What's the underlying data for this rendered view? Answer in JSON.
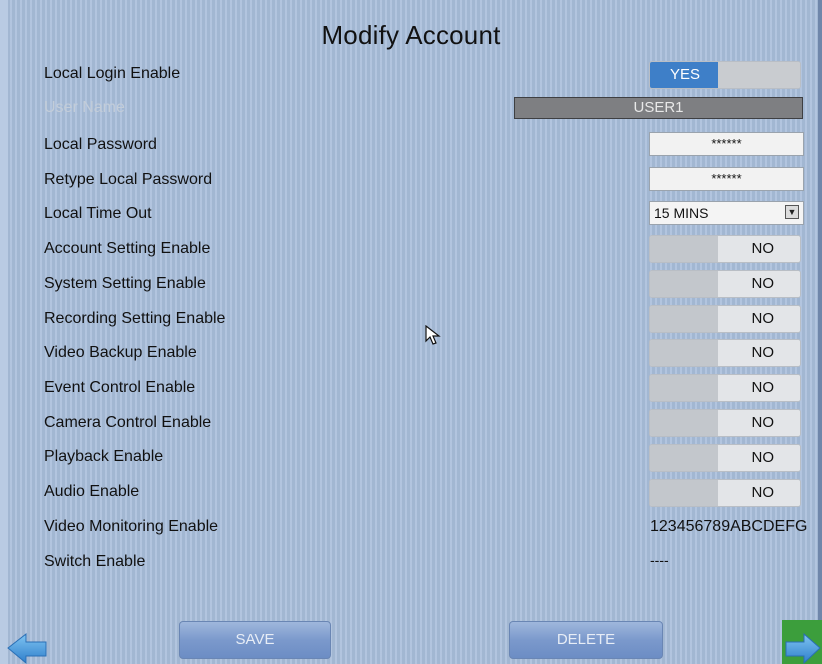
{
  "title": "Modify Account",
  "fields": {
    "local_login": {
      "label": "Local Login Enable",
      "state": "YES"
    },
    "user_name": {
      "label": "User Name",
      "value": "USER1"
    },
    "local_password": {
      "label": "Local Password",
      "value": "******"
    },
    "retype_password": {
      "label": "Retype Local Password",
      "value": "******"
    },
    "local_timeout": {
      "label": "Local Time Out",
      "value": "15 MINS"
    },
    "account_setting": {
      "label": "Account Setting Enable",
      "state": "NO"
    },
    "system_setting": {
      "label": "System Setting Enable",
      "state": "NO"
    },
    "recording_setting": {
      "label": "Recording Setting Enable",
      "state": "NO"
    },
    "video_backup": {
      "label": "Video Backup Enable",
      "state": "NO"
    },
    "event_control": {
      "label": "Event Control Enable",
      "state": "NO"
    },
    "camera_control": {
      "label": "Camera Control Enable",
      "state": "NO"
    },
    "playback": {
      "label": "Playback Enable",
      "state": "NO"
    },
    "audio": {
      "label": "Audio Enable",
      "state": "NO"
    },
    "video_monitoring": {
      "label": "Video Monitoring Enable",
      "value": "123456789ABCDEFG"
    },
    "switch": {
      "label": "Switch Enable",
      "value": "----"
    }
  },
  "buttons": {
    "save": "SAVE",
    "delete": "DELETE"
  },
  "nav": {
    "back_icon": "arrow-left-icon",
    "next_icon": "arrow-right-icon"
  },
  "colors": {
    "toggle_on": "#3e7fc8",
    "background": "#a9bedb",
    "next_bg": "#3c9e3c"
  }
}
